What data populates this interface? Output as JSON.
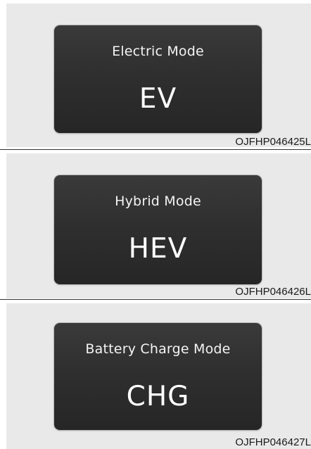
{
  "figures": [
    {
      "mode_label": "Electric Mode",
      "mode_code": "EV",
      "figure_code": "OJFHP046425L"
    },
    {
      "mode_label": "Hybrid Mode",
      "mode_code": "HEV",
      "figure_code": "OJFHP046426L"
    },
    {
      "mode_label": "Battery Charge Mode",
      "mode_code": "CHG",
      "figure_code": "OJFHP046427L"
    }
  ],
  "colors": {
    "panel_background": "#e9e9e9",
    "screen_background": "#2f2f2f",
    "screen_text": "#ffffff"
  }
}
